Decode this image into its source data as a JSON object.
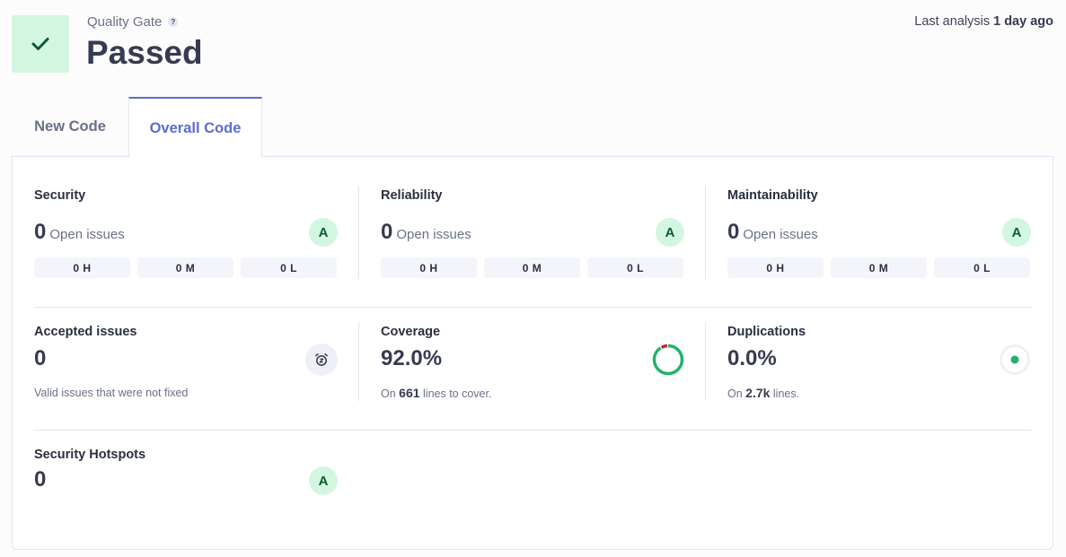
{
  "quality_gate": {
    "label": "Quality Gate",
    "help_glyph": "?",
    "status": "Passed",
    "status_icon": "check-icon",
    "status_color": "#d3f6e0"
  },
  "last_analysis": {
    "label": "Last analysis",
    "value": "1 day ago"
  },
  "tabs": [
    {
      "label": "New Code",
      "active": false
    },
    {
      "label": "Overall Code",
      "active": true
    }
  ],
  "metrics": {
    "security": {
      "title": "Security",
      "count": "0",
      "count_label": "Open issues",
      "rating": "A",
      "severities": [
        "0 H",
        "0 M",
        "0 L"
      ]
    },
    "reliability": {
      "title": "Reliability",
      "count": "0",
      "count_label": "Open issues",
      "rating": "A",
      "severities": [
        "0 H",
        "0 M",
        "0 L"
      ]
    },
    "maintainability": {
      "title": "Maintainability",
      "count": "0",
      "count_label": "Open issues",
      "rating": "A",
      "severities": [
        "0 H",
        "0 M",
        "0 L"
      ]
    },
    "accepted_issues": {
      "title": "Accepted issues",
      "count": "0",
      "description": "Valid issues that were not fixed",
      "icon": "alarm-snooze-icon"
    },
    "coverage": {
      "title": "Coverage",
      "value": "92.0%",
      "percent": 92.0,
      "sub_prefix": "On",
      "sub_value": "661",
      "sub_suffix": "lines to cover."
    },
    "duplications": {
      "title": "Duplications",
      "value": "0.0%",
      "percent": 0.0,
      "sub_prefix": "On",
      "sub_value": "2.7k",
      "sub_suffix": "lines."
    },
    "security_hotspots": {
      "title": "Security Hotspots",
      "count": "0",
      "rating": "A"
    }
  },
  "colors": {
    "accent": "#5d6cd0",
    "good": "#23b26a",
    "bad": "#c2262a",
    "rating_bg": "#d3f6e0",
    "rating_fg": "#0e5a32"
  }
}
